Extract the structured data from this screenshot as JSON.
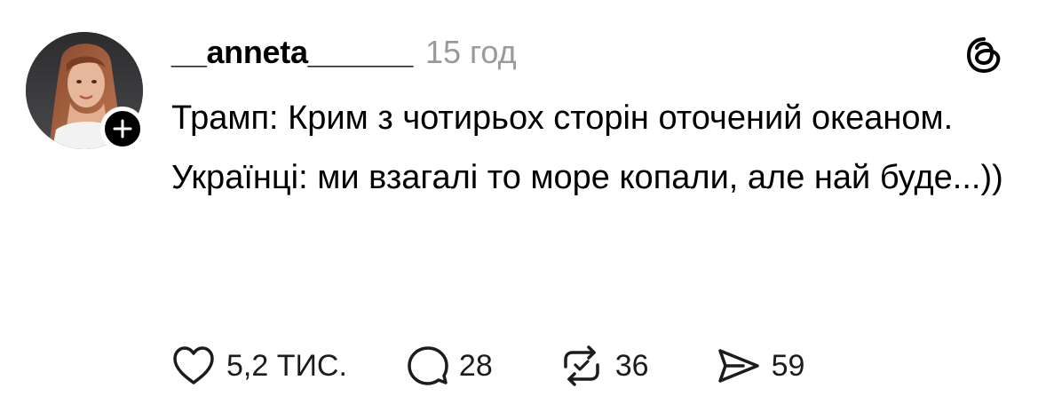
{
  "post": {
    "username": "__anneta______",
    "timestamp": "15 год",
    "paragraphs": [
      "Трамп: Крим з чотирьох сторін  оточений океаном.",
      "Українці: ми взагалі то море копали, але най буде...))"
    ]
  },
  "actions": {
    "likes": "5,2 ТИС.",
    "comments": "28",
    "reposts": "36",
    "shares": "59"
  },
  "icons": {
    "avatar": "profile-photo",
    "follow": "plus-icon",
    "logo": "threads-logo-icon",
    "like": "heart-icon",
    "comment": "comment-bubble-icon",
    "repost": "repost-icon",
    "share": "share-send-icon"
  },
  "colors": {
    "text": "#000000",
    "muted": "#9a9a9a",
    "background": "#ffffff"
  }
}
